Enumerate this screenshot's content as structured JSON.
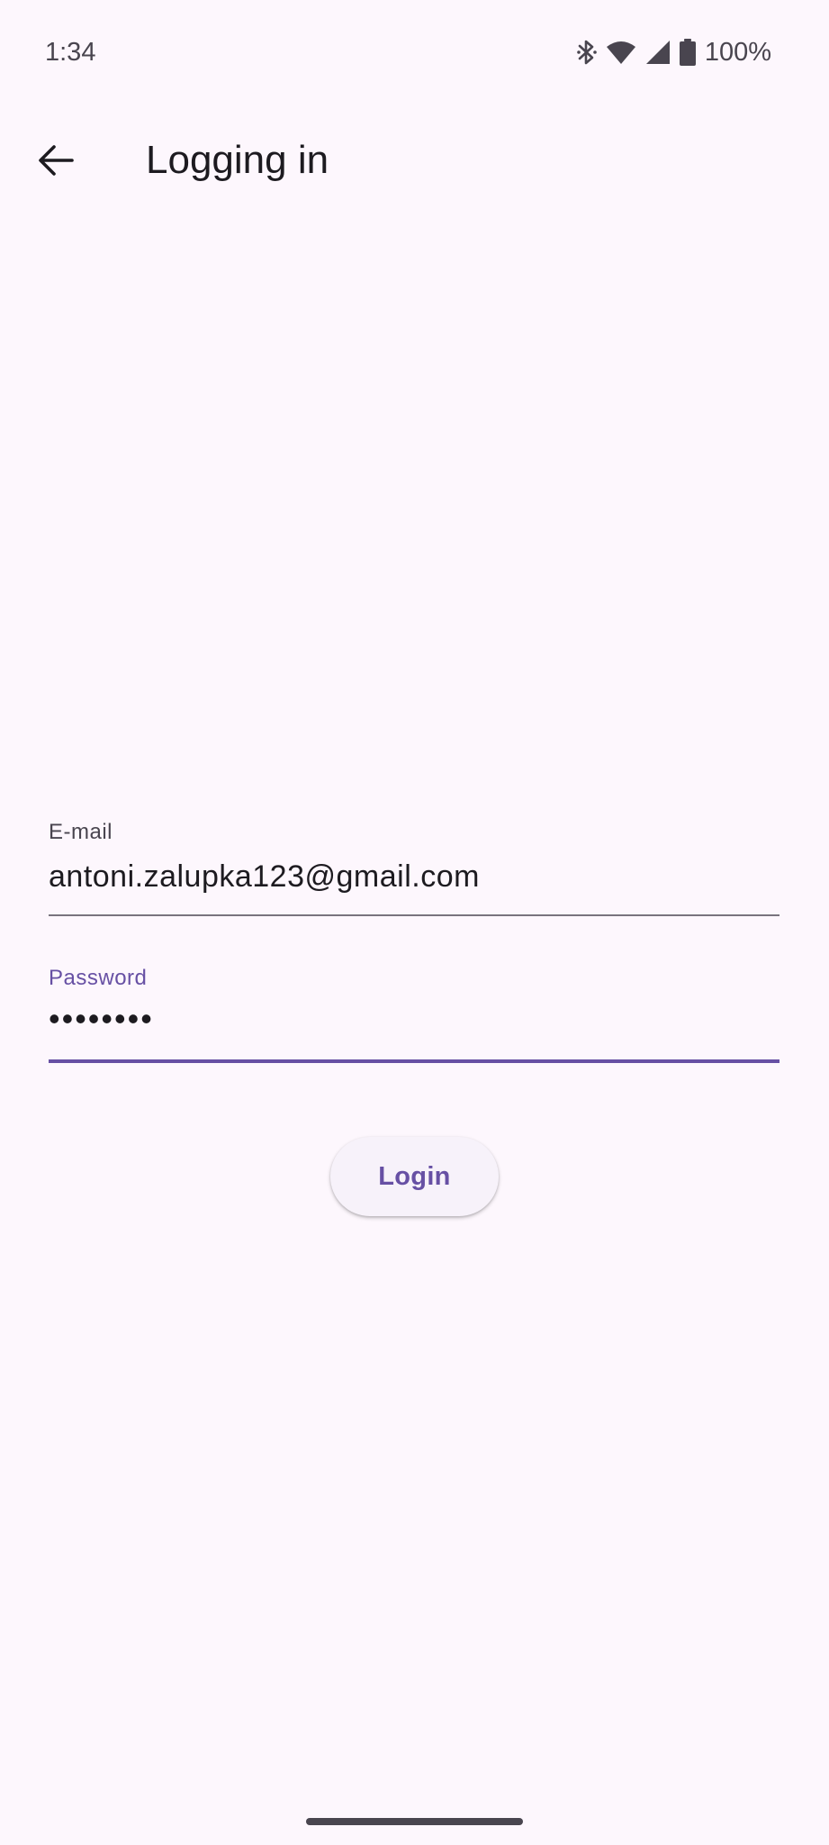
{
  "status_bar": {
    "time": "1:34",
    "battery_percent": "100%",
    "icons": [
      "bluetooth-icon",
      "wifi-icon",
      "cell-signal-icon",
      "battery-icon"
    ]
  },
  "app_bar": {
    "back_icon": "arrow-back-icon",
    "title": "Logging in"
  },
  "form": {
    "email": {
      "label": "E-mail",
      "value": "antoni.zalupka123@gmail.com"
    },
    "password": {
      "label": "Password",
      "value": "••••••••"
    },
    "login_label": "Login"
  },
  "colors": {
    "background": "#fdf7fd",
    "primary": "#6750a4",
    "on_surface": "#1d1b20",
    "on_surface_variant": "#49454f",
    "outline": "#79747e",
    "button_surface": "#f7f2fa"
  }
}
